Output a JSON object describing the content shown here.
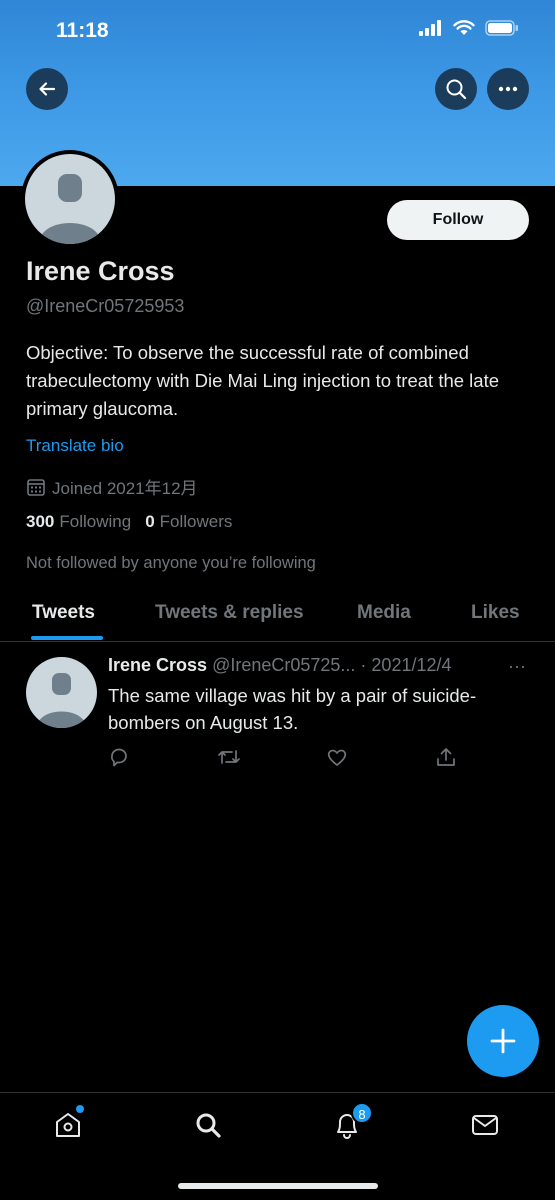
{
  "status_bar": {
    "time": "11:18"
  },
  "profile": {
    "name": "Irene Cross",
    "handle": "@IreneCr05725953",
    "bio": "Objective: To observe the successful rate of combined trabeculectomy with Die Mai Ling injection to treat the late primary glaucoma.",
    "translate_label": "Translate bio",
    "joined": "Joined 2021年12月",
    "following_count": "300",
    "following_label": "Following",
    "followers_count": "0",
    "followers_label": "Followers",
    "not_followed": "Not followed by anyone you’re following",
    "follow_button": "Follow"
  },
  "tabs": [
    {
      "label": "Tweets",
      "active": true
    },
    {
      "label": "Tweets & replies",
      "active": false
    },
    {
      "label": "Media",
      "active": false
    },
    {
      "label": "Likes",
      "active": false
    }
  ],
  "tweet": {
    "name": "Irene Cross",
    "handle": "@IreneCr05725...",
    "separator": " · ",
    "date": "2021/12/4",
    "more": "···",
    "text": "The same village was hit by a pair of suicide-bombers on August 13."
  },
  "bottom_nav": {
    "notifications_badge": "8"
  },
  "icons": [
    "back-arrow-icon",
    "search-icon",
    "more-icon",
    "calendar-icon",
    "reply-icon",
    "retweet-icon",
    "like-icon",
    "share-icon",
    "compose-icon",
    "home-icon",
    "explore-icon",
    "notifications-icon",
    "messages-icon"
  ],
  "colors": {
    "accent": "#1d9bf0",
    "banner": "#3f9be7",
    "background": "#000000",
    "muted_text": "#71767b"
  }
}
